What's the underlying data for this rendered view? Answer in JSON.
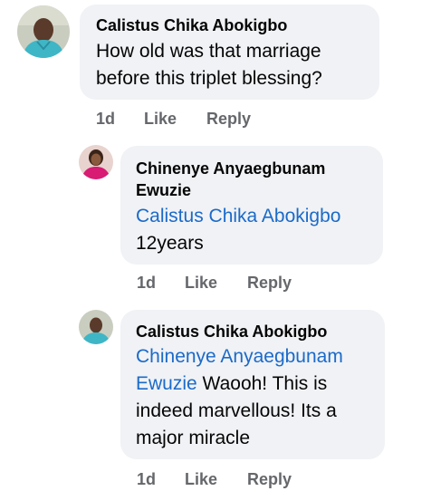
{
  "comments": [
    {
      "author": "Calistus Chika Abokigbo",
      "mention_line1": "",
      "text_line1": "How old was that marriage",
      "text_line2": "before this triplet blessing?",
      "time": "1d",
      "like": "Like",
      "reply": "Reply",
      "avatar": "male-profile-photo"
    },
    {
      "author_line1": "Chinenye Anyaegbunam",
      "author_line2": "Ewuzie",
      "mention": "Calistus Chika Abokigbo",
      "text": "12years",
      "time": "1d",
      "like": "Like",
      "reply": "Reply",
      "avatar": "female-profile-photo"
    },
    {
      "author": "Calistus Chika Abokigbo",
      "mention_line1": "Chinenye Anyaegbunam",
      "mention_line2": "Ewuzie",
      "text_line2": " Waooh! This is",
      "text_line3": "indeed marvellous! Its a",
      "text_line4": "major miracle",
      "time": "1d",
      "like": "Like",
      "reply": "Reply",
      "avatar": "male-profile-photo"
    }
  ],
  "colors": {
    "bubble": "#f0f2f5",
    "mention": "#1b6ac9",
    "action": "#65676b",
    "text": "#050505"
  }
}
